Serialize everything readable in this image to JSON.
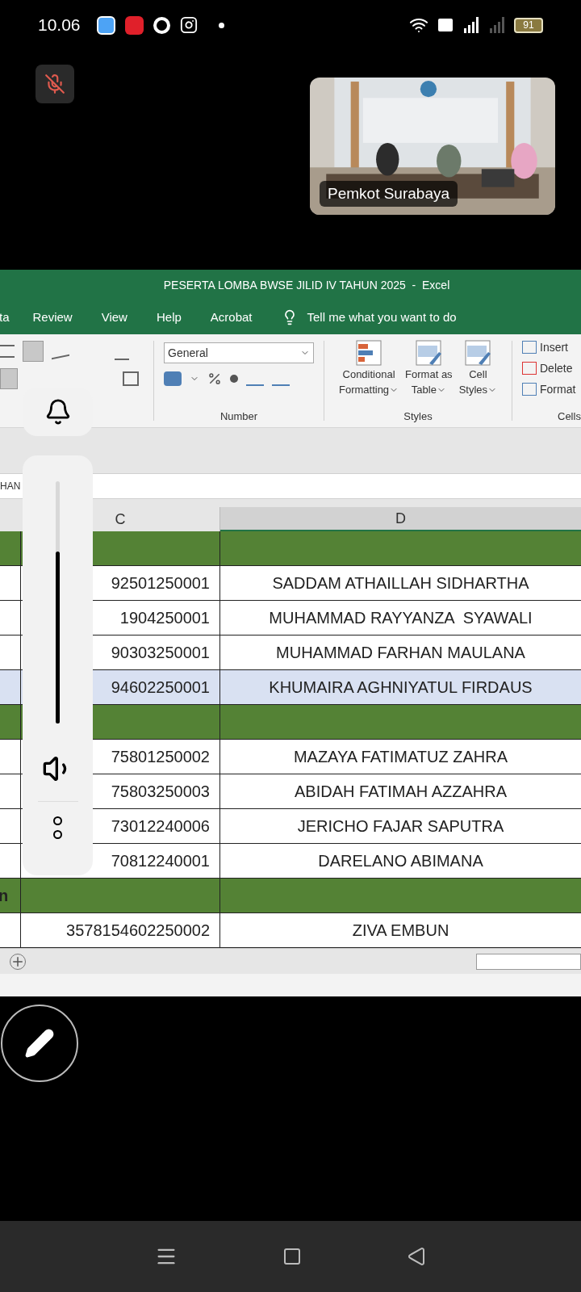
{
  "status_bar": {
    "time": "10.06",
    "battery": "91"
  },
  "meeting": {
    "mic_muted": true,
    "video_label": "Pemkot Surabaya"
  },
  "excel": {
    "title": "PESERTA LOMBA BWSE JILID IV TAHUN 2025  -  Excel",
    "tabs": [
      {
        "label": "ta",
        "selected": false
      },
      {
        "label": "Review",
        "selected": false
      },
      {
        "label": "View",
        "selected": false
      },
      {
        "label": "Help",
        "selected": false
      },
      {
        "label": "Acrobat",
        "selected": false
      }
    ],
    "tell_me": "Tell me what you want to do",
    "number_format": "General",
    "style_buttons": [
      {
        "line1": "Conditional",
        "line2": "Formatting",
        "kind": "conditional"
      },
      {
        "line1": "Format as",
        "line2": "Table",
        "kind": "table"
      },
      {
        "line1": "Cell",
        "line2": "Styles",
        "kind": "cellstyles"
      }
    ],
    "cells_buttons": [
      {
        "label": "Insert",
        "kind": "insert"
      },
      {
        "label": "Delete",
        "kind": "delete"
      },
      {
        "label": "Format",
        "kind": "format"
      }
    ],
    "group_labels": [
      "Number",
      "Styles",
      "Cells"
    ],
    "name_box": "HAN",
    "columns": [
      "C",
      "D"
    ],
    "rows": [
      {
        "kind": "group",
        "b": "",
        "c": "",
        "d": "",
        "selected": false
      },
      {
        "kind": "person",
        "b": "",
        "c": "92501250001",
        "d": "SADDAM ATHAILLAH SIDHARTHA",
        "selected": false
      },
      {
        "kind": "person",
        "b": "",
        "c": "1904250001",
        "d": "MUHAMMAD RAYYANZA  SYAWALI",
        "selected": false
      },
      {
        "kind": "person",
        "b": "",
        "c": "90303250001",
        "d": "MUHAMMAD FARHAN MAULANA",
        "selected": false
      },
      {
        "kind": "person",
        "b": "",
        "c": "94602250001",
        "d": "KHUMAIRA AGHNIYATUL FIRDAUS",
        "selected": true
      },
      {
        "kind": "group",
        "b": "",
        "c": "",
        "d": "",
        "selected": false
      },
      {
        "kind": "person",
        "b": "",
        "c": "75801250002",
        "d": "MAZAYA FATIMATUZ ZAHRA",
        "selected": false
      },
      {
        "kind": "person",
        "b": "",
        "c": "75803250003",
        "d": "ABIDAH FATIMAH AZZAHRA",
        "selected": false
      },
      {
        "kind": "person",
        "b": "",
        "c": "73012240006",
        "d": "JERICHO FAJAR SAPUTRA",
        "selected": false
      },
      {
        "kind": "person",
        "b": "",
        "c": "70812240001",
        "d": "DARELANO ABIMANA",
        "selected": false
      },
      {
        "kind": "group",
        "b": "n",
        "c": "",
        "d": "",
        "selected": false
      },
      {
        "kind": "person",
        "b": "",
        "c": "3578154602250002",
        "d": "ZIVA EMBUN",
        "selected": false
      }
    ]
  },
  "volume": {
    "level": 0.71
  }
}
